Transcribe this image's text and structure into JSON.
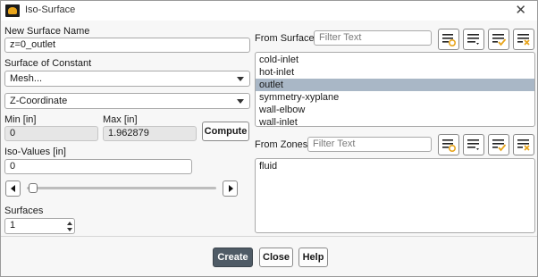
{
  "window": {
    "title": "Iso-Surface",
    "close_glyph": "✕"
  },
  "new_surface": {
    "label": "New Surface Name",
    "value": "z=0_outlet"
  },
  "surface_of_constant": {
    "label": "Surface of Constant",
    "category": "Mesh...",
    "quantity": "Z-Coordinate"
  },
  "range": {
    "min_label": "Min [in]",
    "min_value": "0",
    "max_label": "Max [in]",
    "max_value": "1.962879",
    "compute_label": "Compute"
  },
  "iso_values": {
    "label": "Iso-Values [in]",
    "value": "0",
    "slider_fraction": 0
  },
  "surfaces": {
    "label": "Surfaces",
    "value": "1"
  },
  "from_surface": {
    "label": "From Surface",
    "filter_placeholder": "Filter Text",
    "items": [
      "cold-inlet",
      "hot-inlet",
      "outlet",
      "symmetry-xyplane",
      "wall-elbow",
      "wall-inlet"
    ],
    "selected": "outlet"
  },
  "from_zones": {
    "label": "From Zones",
    "filter_placeholder": "Filter Text",
    "items": [
      "fluid"
    ]
  },
  "icons": [
    "filter-select-icon",
    "filter-list-icon",
    "select-all-icon",
    "deselect-all-icon"
  ],
  "buttons": {
    "create": "Create",
    "close": "Close",
    "help": "Help"
  },
  "colors": {
    "selection": "#a9b7c6",
    "primary_button": "#4f5b66",
    "icon_accent": "#e8a51c"
  }
}
